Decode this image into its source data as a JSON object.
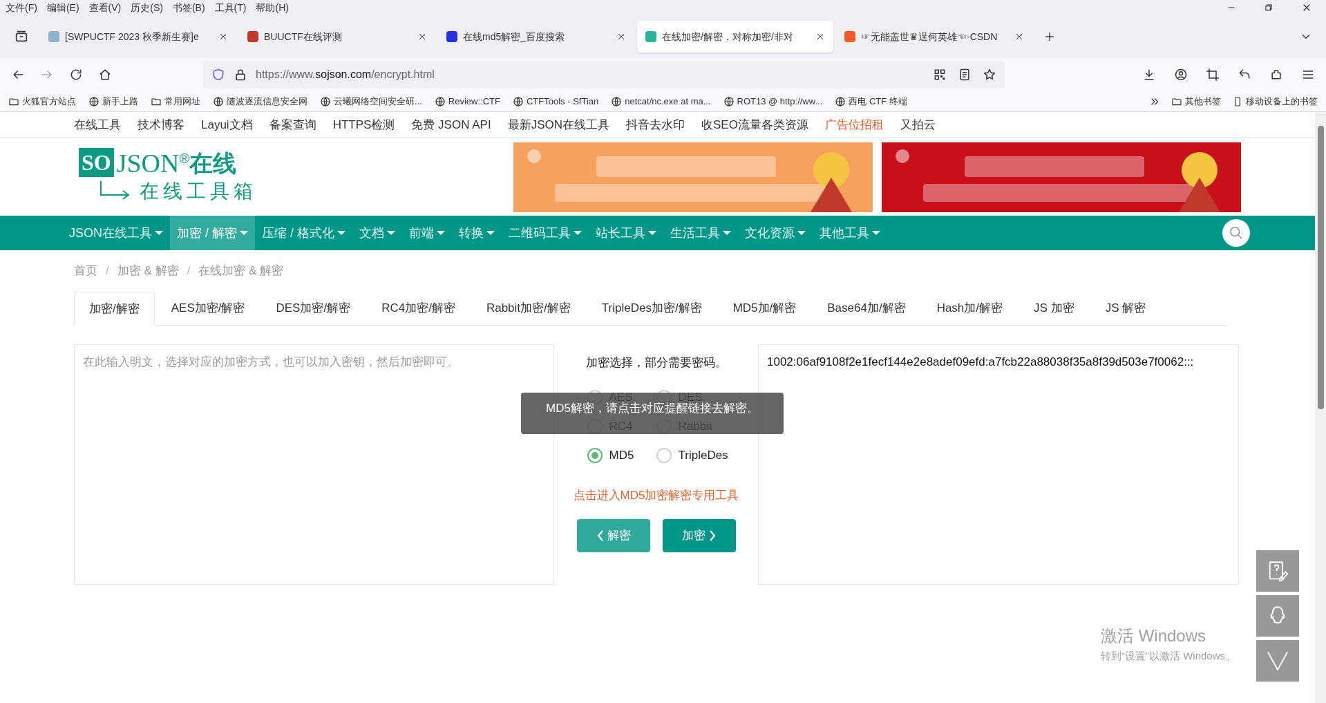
{
  "menu_bar": [
    "文件(F)",
    "编辑(E)",
    "查看(V)",
    "历史(S)",
    "书签(B)",
    "工具(T)",
    "帮助(H)"
  ],
  "browser_tabs": [
    {
      "title": "[SWPUCTF 2023 秋季新生赛]e",
      "selected": false
    },
    {
      "title": "BUUCTF在线评测",
      "selected": false
    },
    {
      "title": "在线md5解密_百度搜索",
      "selected": false
    },
    {
      "title": "在线加密/解密，对称加密/非对",
      "selected": true
    },
    {
      "title": "☞无能盖世♛逞何英雄☜-CSDN",
      "selected": false
    }
  ],
  "address": {
    "prefix": "https://www.",
    "domain": "sojson.com",
    "path": "/encrypt.html"
  },
  "bookmarks": [
    {
      "label": "火狐官方站点",
      "kind": "folder"
    },
    {
      "label": "新手上路",
      "kind": "site"
    },
    {
      "label": "常用网址",
      "kind": "folder"
    },
    {
      "label": "随波逐流信息安全网",
      "kind": "site"
    },
    {
      "label": "云曦网络空间安全研...",
      "kind": "site"
    },
    {
      "label": "Review::CTF",
      "kind": "site"
    },
    {
      "label": "CTFTools - SfTian",
      "kind": "site"
    },
    {
      "label": "netcat/nc.exe at ma...",
      "kind": "site"
    },
    {
      "label": "ROT13 @ http://ww...",
      "kind": "site"
    },
    {
      "label": "西电 CTF 终端",
      "kind": "site"
    }
  ],
  "bookmarks_right": [
    {
      "label": "其他书签",
      "kind": "folder"
    },
    {
      "label": "移动设备上的书签",
      "kind": "mobile"
    }
  ],
  "top_links": [
    {
      "label": "在线工具",
      "highlight": false
    },
    {
      "label": "技术博客",
      "highlight": false
    },
    {
      "label": "Layui文档",
      "highlight": false
    },
    {
      "label": "备案查询",
      "highlight": false
    },
    {
      "label": "HTTPS检测",
      "highlight": false
    },
    {
      "label": "免费 JSON API",
      "highlight": false
    },
    {
      "label": "最新JSON在线工具",
      "highlight": false
    },
    {
      "label": "抖音去水印",
      "highlight": false
    },
    {
      "label": "收SEO流量各类资源",
      "highlight": false
    },
    {
      "label": "广告位招租",
      "highlight": true
    },
    {
      "label": "又拍云",
      "highlight": false
    }
  ],
  "logo": {
    "mark": "SO",
    "name": "JSON",
    "reg": "®",
    "suffix": "在线",
    "tagline": "在线工具箱"
  },
  "main_nav": [
    {
      "label": "JSON在线工具",
      "selected": false
    },
    {
      "label": "加密 / 解密",
      "selected": true
    },
    {
      "label": "压缩 / 格式化",
      "selected": false
    },
    {
      "label": "文档",
      "selected": false
    },
    {
      "label": "前端",
      "selected": false
    },
    {
      "label": "转换",
      "selected": false
    },
    {
      "label": "二维码工具",
      "selected": false
    },
    {
      "label": "站长工具",
      "selected": false
    },
    {
      "label": "生活工具",
      "selected": false
    },
    {
      "label": "文化资源",
      "selected": false
    },
    {
      "label": "其他工具",
      "selected": false
    }
  ],
  "breadcrumb": [
    {
      "label": "首页",
      "kind": "link"
    },
    {
      "label": "/",
      "kind": "separator"
    },
    {
      "label": "加密 & 解密",
      "kind": "link"
    },
    {
      "label": "/",
      "kind": "separator"
    },
    {
      "label": "在线加密 & 解密",
      "kind": "link"
    }
  ],
  "tool_tabs": [
    {
      "label": "加密/解密",
      "selected": true
    },
    {
      "label": "AES加密/解密",
      "selected": false
    },
    {
      "label": "DES加密/解密",
      "selected": false
    },
    {
      "label": "RC4加密/解密",
      "selected": false
    },
    {
      "label": "Rabbit加密/解密",
      "selected": false
    },
    {
      "label": "TripleDes加密/解密",
      "selected": false
    },
    {
      "label": "MD5加/解密",
      "selected": false
    },
    {
      "label": "Base64加/解密",
      "selected": false
    },
    {
      "label": "Hash加/解密",
      "selected": false
    },
    {
      "label": "JS 加密",
      "selected": false
    },
    {
      "label": "JS 解密",
      "selected": false
    }
  ],
  "input": {
    "placeholder": "在此输入明文，选择对应的加密方式，也可以加入密钥，然后加密即可。"
  },
  "options_title": "加密选择，部分需要密码。",
  "algorithms": [
    {
      "label": "AES",
      "selected": false
    },
    {
      "label": "DES",
      "selected": false
    },
    {
      "label": "RC4",
      "selected": false
    },
    {
      "label": "Rabbit",
      "selected": false
    },
    {
      "label": "MD5",
      "selected": true
    },
    {
      "label": "TripleDes",
      "selected": false
    }
  ],
  "tooltip": "MD5解密，请点击对应提醒链接去解密。",
  "md5_link": "点击进入MD5加密解密专用工具",
  "buttons": [
    {
      "label": "解密",
      "kind": "back"
    },
    {
      "label": "加密",
      "kind": "forward"
    }
  ],
  "output": {
    "value": "1002:06af9108f2e1fecf144e2e8adef09efd:a7fcb22a88038f35a8f39d503e7f0062:::"
  },
  "activation": {
    "title": "激活 Windows",
    "hint": "转到“设置”以激活 Windows。"
  }
}
